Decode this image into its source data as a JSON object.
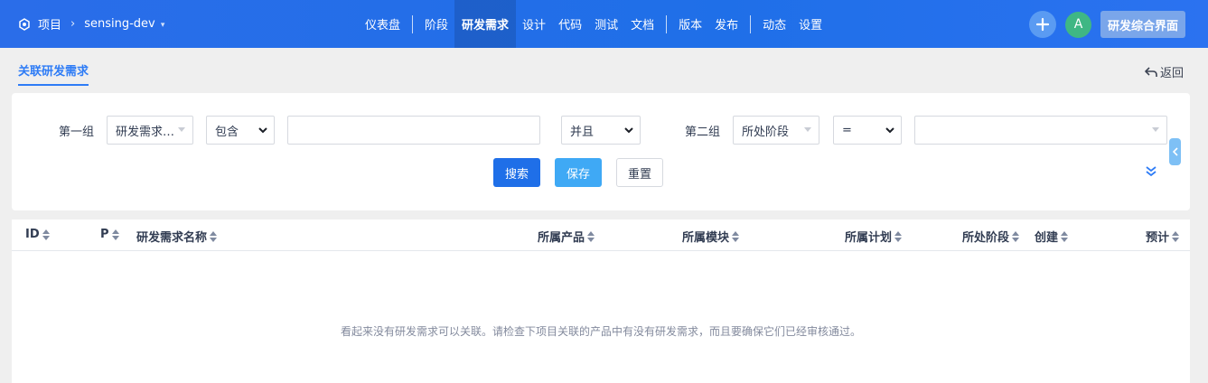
{
  "header": {
    "project_label": "项目",
    "project_name": "sensing-dev",
    "nav": [
      {
        "label": "仪表盘"
      },
      {
        "label": "阶段"
      },
      {
        "label": "研发需求"
      },
      {
        "label": "设计"
      },
      {
        "label": "代码"
      },
      {
        "label": "测试"
      },
      {
        "label": "文档"
      },
      {
        "label": "版本"
      },
      {
        "label": "发布"
      },
      {
        "label": "动态"
      },
      {
        "label": "设置"
      }
    ],
    "active_nav": "研发需求",
    "avatar_initial": "A",
    "ui_switch_label": "研发综合界面"
  },
  "subheader": {
    "tab_label": "关联研发需求",
    "back_label": "返回"
  },
  "search": {
    "group1_label": "第一组",
    "group1_field": "研发需求…",
    "group1_operator": "包含",
    "group1_value": "",
    "logic": "并且",
    "group2_label": "第二组",
    "group2_field": "所处阶段",
    "group2_operator": "=",
    "group2_value": "",
    "search_button": "搜索",
    "save_button": "保存",
    "reset_button": "重置"
  },
  "table": {
    "columns": [
      "ID",
      "P",
      "研发需求名称",
      "所属产品",
      "所属模块",
      "所属计划",
      "所处阶段",
      "创建",
      "预计"
    ],
    "empty_message": "看起来没有研发需求可以关联。请检查下项目关联的产品中有没有研发需求，而且要确保它们已经审核通过。"
  },
  "colors": {
    "header_bg": "#1f6fe8",
    "accent": "#2e7cf6",
    "save_button": "#3fa9f5",
    "avatar": "#3fb784"
  }
}
